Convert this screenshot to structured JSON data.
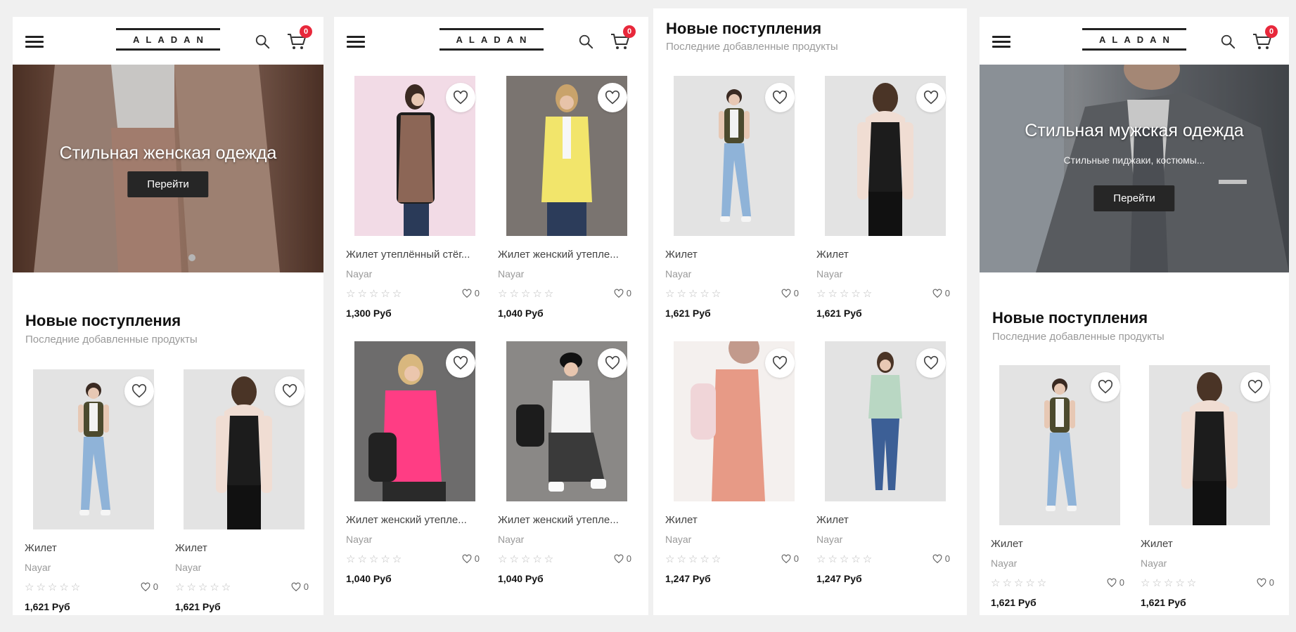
{
  "brand": {
    "logo": "ALADAN",
    "cart_count": "0"
  },
  "screens": [
    {
      "hero": {
        "title": "Стильная женская одежда",
        "button": "Перейти"
      },
      "section": {
        "title": "Новые поступления",
        "subtitle": "Последние добавленные продукты"
      },
      "products": [
        {
          "name": "Жилет",
          "brand": "Naуar",
          "likes": "0",
          "price": "1,621 Руб"
        },
        {
          "name": "Жилет",
          "brand": "Naуar",
          "likes": "0",
          "price": "1,621 Руб"
        }
      ]
    },
    {
      "products": [
        {
          "name": "Жилет утеплённый стёг...",
          "brand": "Naуar",
          "likes": "0",
          "price": "1,300 Руб"
        },
        {
          "name": "Жилет женский утепле...",
          "brand": "Naуar",
          "likes": "0",
          "price": "1,040 Руб"
        },
        {
          "name": "Жилет женский утепле...",
          "brand": "Naуar",
          "likes": "0",
          "price": "1,040 Руб"
        },
        {
          "name": "Жилет женский утепле...",
          "brand": "Naуar",
          "likes": "0",
          "price": "1,040 Руб"
        }
      ]
    },
    {
      "section": {
        "title": "Новые поступления",
        "subtitle": "Последние добавленные продукты"
      },
      "products": [
        {
          "name": "Жилет",
          "brand": "Naуar",
          "likes": "0",
          "price": "1,621 Руб"
        },
        {
          "name": "Жилет",
          "brand": "Naуar",
          "likes": "0",
          "price": "1,621 Руб"
        },
        {
          "name": "Жилет",
          "brand": "Naуar",
          "likes": "0",
          "price": "1,247 Руб"
        },
        {
          "name": "Жилет",
          "brand": "Naуar",
          "likes": "0",
          "price": "1,247 Руб"
        }
      ]
    },
    {
      "hero": {
        "title": "Стильная мужская одежда",
        "subtitle": "Стильные пиджаки, костюмы...",
        "button": "Перейти"
      },
      "section": {
        "title": "Новые поступления",
        "subtitle": "Последние добавленные продукты"
      },
      "products": [
        {
          "name": "Жилет",
          "brand": "Naуar",
          "likes": "0",
          "price": "1,621 Руб"
        },
        {
          "name": "Жилет",
          "brand": "Naуar",
          "likes": "0",
          "price": "1,621 Руб"
        }
      ]
    }
  ],
  "stars": "☆☆☆☆☆",
  "colors": {
    "accent": "#e8283b",
    "dark_button": "#262626",
    "muted_text": "#9a9a9a"
  },
  "icons": [
    "menu-icon",
    "search-icon",
    "cart-icon",
    "heart-icon",
    "star-icon"
  ]
}
